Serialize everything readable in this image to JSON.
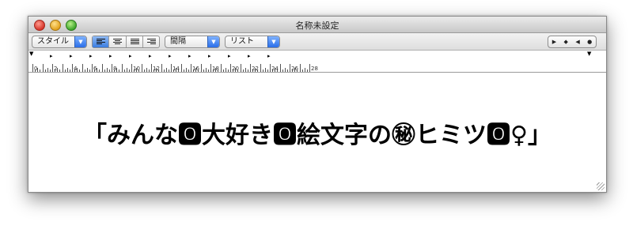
{
  "window": {
    "title": "名称未設定"
  },
  "toolbar": {
    "style_popup": "スタイル",
    "spacing_popup": "間隔",
    "list_popup": "リスト",
    "align_buttons": [
      "align-left",
      "align-center",
      "align-justify",
      "align-right"
    ],
    "selected_align": "align-left"
  },
  "ruler": {
    "numbers": [
      "0",
      "2",
      "4",
      "6",
      "8",
      "10",
      "12",
      "14",
      "16",
      "18",
      "20",
      "22",
      "24",
      "26",
      "28"
    ]
  },
  "document": {
    "text": "「みんな🅾大好き🅾絵文字の㊙ヒミツ🅾♀」"
  },
  "icons": [
    "close-icon",
    "minimize-icon",
    "zoom-icon",
    "dropdown-arrow-icon",
    "tab-stop-icon",
    "resize-grip-icon"
  ]
}
